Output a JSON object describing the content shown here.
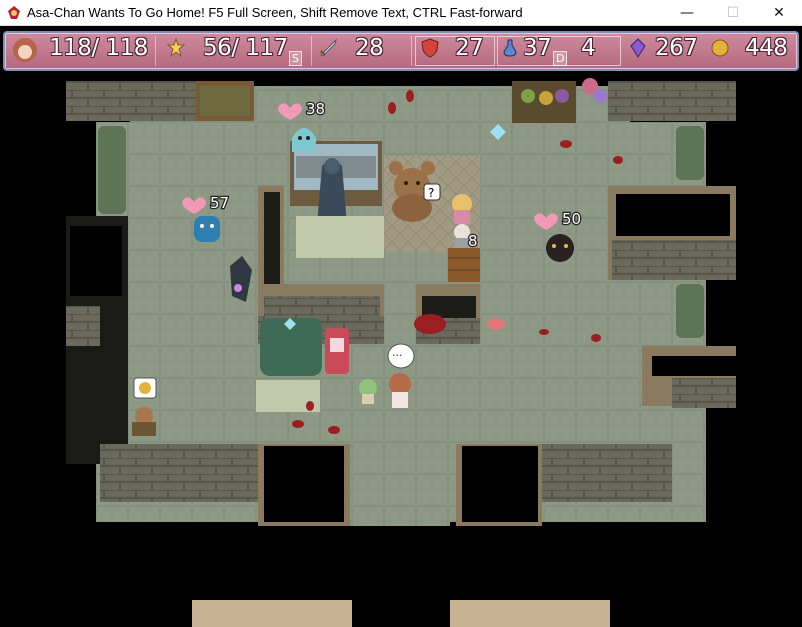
{
  "window": {
    "title": "Asa-Chan Wants To Go Home! F5 Full Screen, Shift Remove Text, CTRL Fast-forward",
    "minimize_glyph": "—",
    "maximize_glyph": "☐",
    "close_glyph": "✕"
  },
  "hud": {
    "hp": "118/ 118",
    "sp": "56/ 117",
    "sp_key": "S",
    "attack": "28",
    "defense": "27",
    "potions": "37",
    "potions_key": "D",
    "keys": "4",
    "crystals": "267",
    "gold": "448"
  },
  "enemies": [
    {
      "name": "ghost",
      "hp": "38"
    },
    {
      "name": "blue-slime",
      "hp": "57"
    },
    {
      "name": "dark-blob",
      "hp": "50"
    }
  ],
  "npc_counter": "8",
  "npc_question": "?",
  "speech": "...",
  "icons": [
    "app-icon",
    "heart-icon",
    "star-person-icon",
    "sword-icon",
    "shield-icon",
    "potion-icon",
    "crystal-icon",
    "coin-icon"
  ]
}
